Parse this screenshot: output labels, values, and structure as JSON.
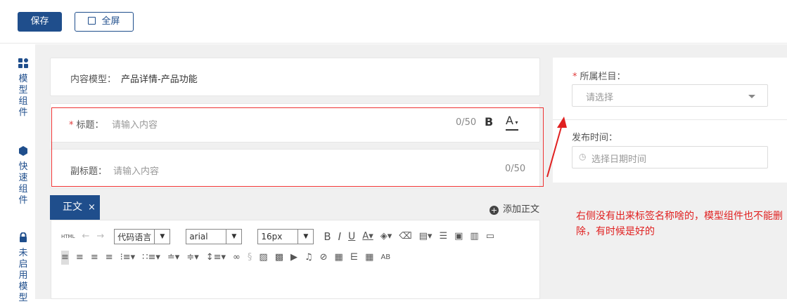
{
  "toolbar": {
    "save_label": "保存",
    "fullscreen_label": "全屏"
  },
  "sidebar": {
    "items": [
      {
        "icon": "grid-icon",
        "label": "模型组件"
      },
      {
        "icon": "cube-icon",
        "label": "快速组件"
      },
      {
        "icon": "lock-icon",
        "label": "未启用模型"
      }
    ]
  },
  "form": {
    "content_model_label": "内容模型：",
    "content_model_value": "产品详情-产品功能",
    "title_required_mark": "*",
    "title_label": "标题：",
    "title_placeholder": "请输入内容",
    "title_count": "0/50",
    "bold_label": "B",
    "font_color_label": "A",
    "subtitle_label": "副标题：",
    "subtitle_placeholder": "请输入内容",
    "subtitle_count": "0/50"
  },
  "tabs": [
    {
      "label": "正文",
      "close": "×"
    }
  ],
  "add_body_label": "添加正文",
  "editor": {
    "html_label": "HTML",
    "code_language": "代码语言",
    "font_family": "arial",
    "font_size": "16px"
  },
  "right_panel": {
    "column_required_mark": "*",
    "column_label": "所属栏目：",
    "column_placeholder": "请选择",
    "publish_label": "发布时间：",
    "publish_placeholder": "选择日期时间"
  },
  "annotation": "右侧没有出来标签名称啥的，模型组件也不能删除，有时候是好的",
  "colors": {
    "brand": "#1f4e8c",
    "annotation_red": "#e02020"
  }
}
